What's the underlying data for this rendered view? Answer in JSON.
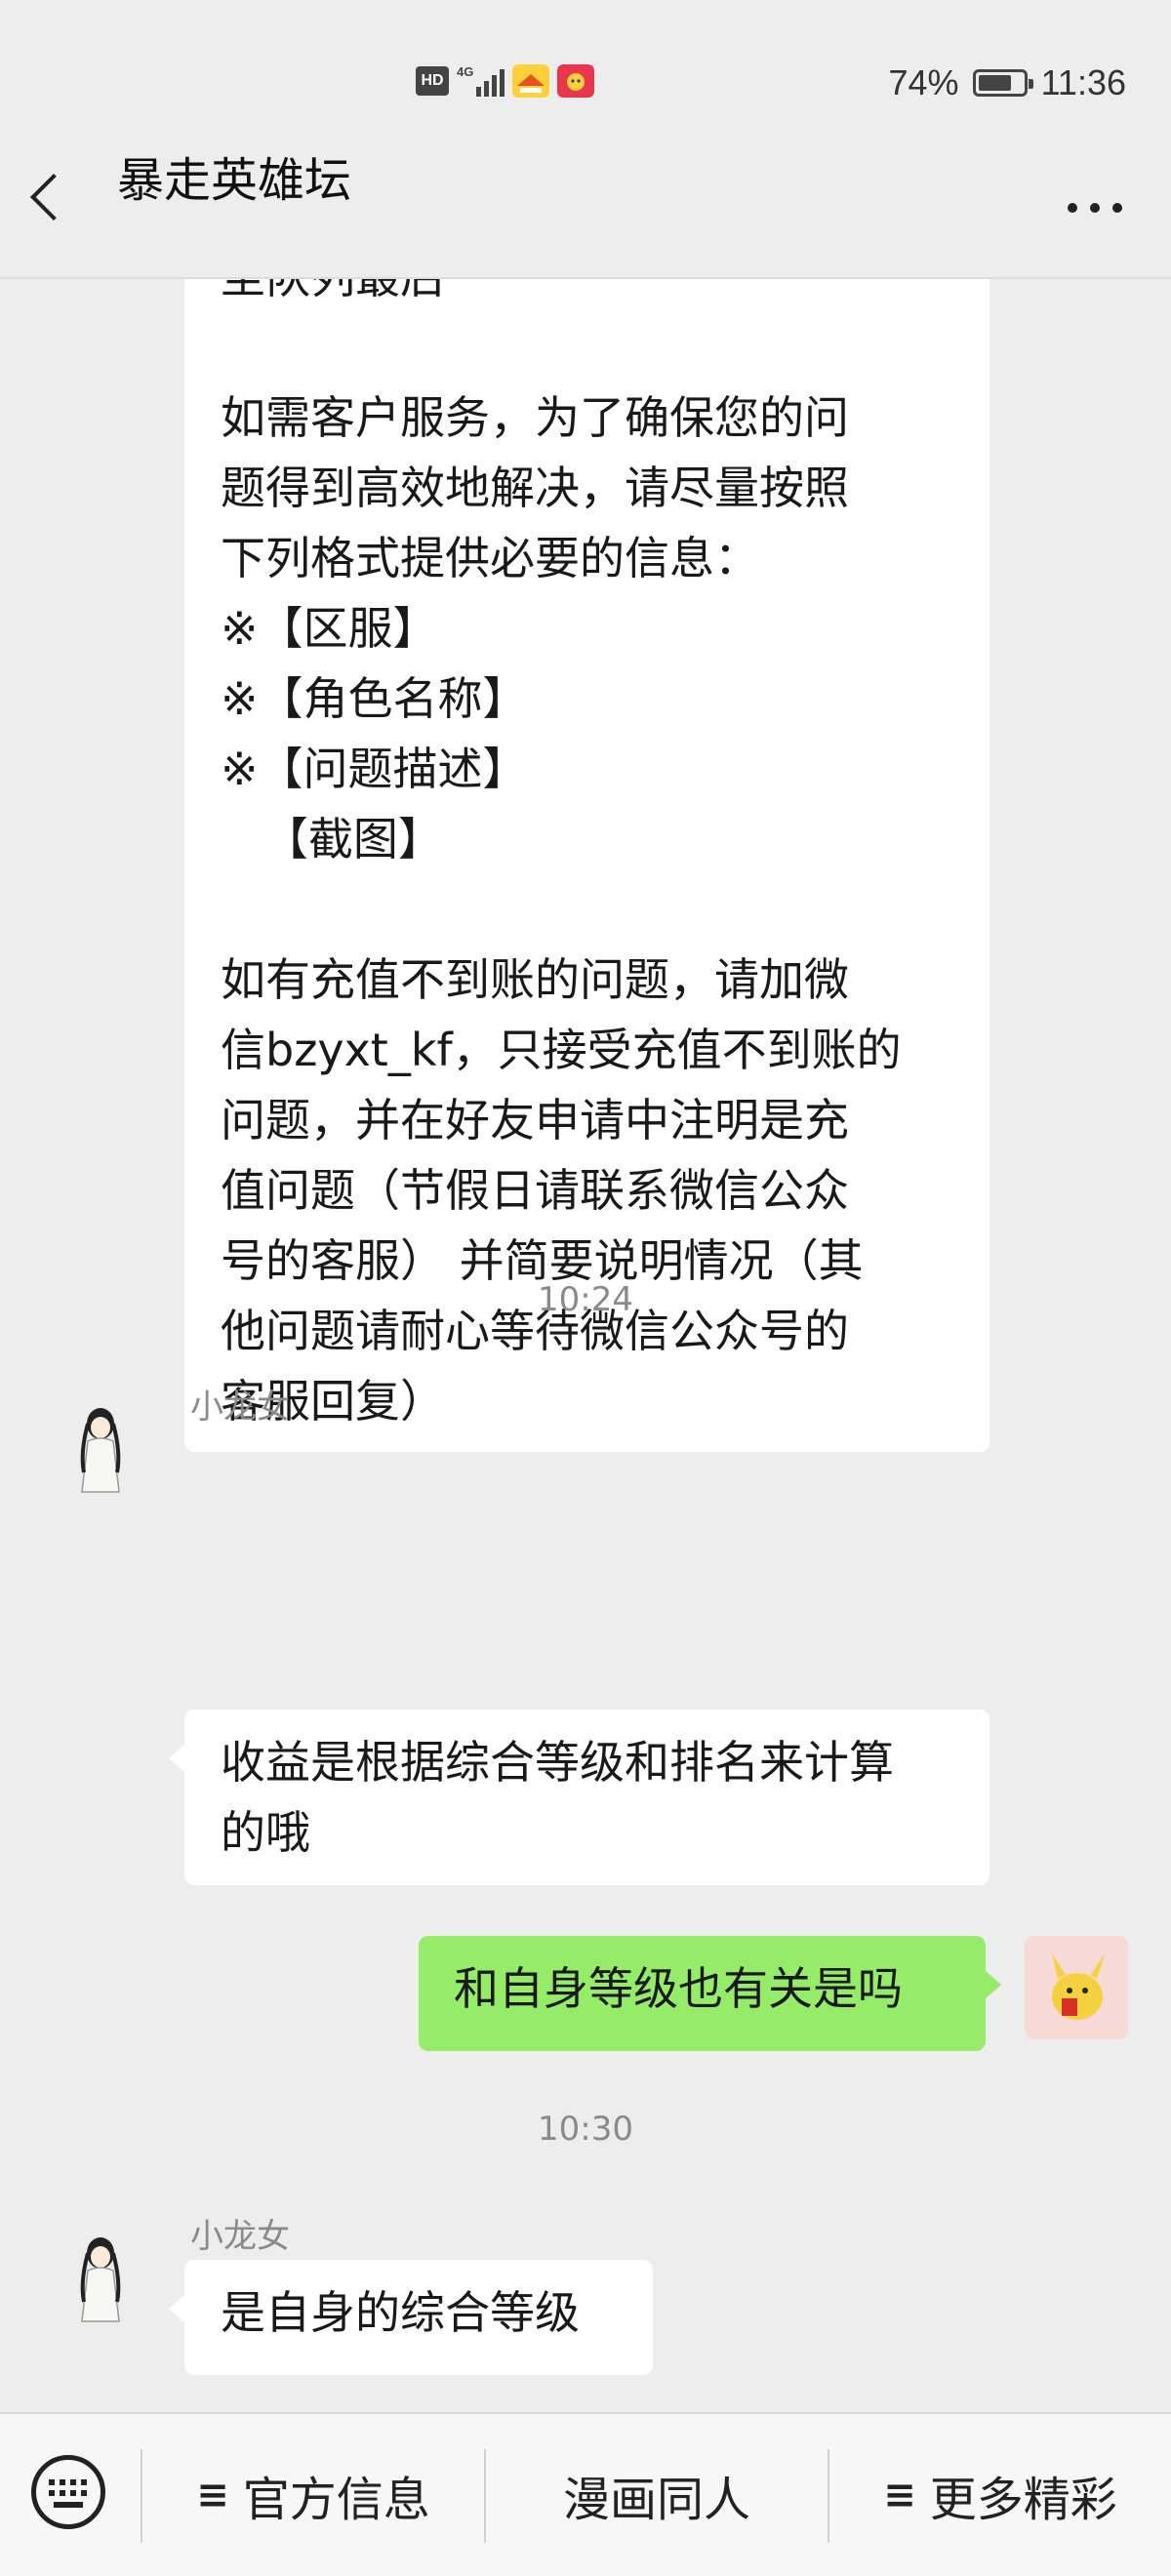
{
  "status_bar": {
    "hd": "HD",
    "network": "4G",
    "battery_percent": "74%",
    "battery_level": 0.74,
    "time": "11:36"
  },
  "nav": {
    "title": "暴走英雄坛",
    "back_icon": "chevron-left-icon",
    "more_icon": "more-dots-icon"
  },
  "messages": {
    "m1_lines": [
      "至队列最后",
      "",
      "如需客户服务，为了确保您的问",
      "题得到高效地解决，请尽量按照",
      "下列格式提供必要的信息：",
      "※【区服】",
      "※【角色名称】",
      "※【问题描述】",
      "   【截图】",
      "",
      "如有充值不到账的问题，请加微",
      "信bzyxt_kf，只接受充值不到账的",
      "问题，并在好友申请中注明是充",
      "值问题（节假日请联系微信公众",
      "号的客服） 并简要说明情况（其",
      "他问题请耐心等待微信公众号的",
      "客服回复）"
    ],
    "ts1": "10:24",
    "sender1": "小龙女",
    "m2_lines": [
      "收益是根据综合等级和排名来计算",
      "的哦"
    ],
    "m3": "和自身等级也有关是吗",
    "ts2": "10:30",
    "sender2": "小龙女",
    "m4": "是自身的综合等级"
  },
  "bottom_menu": {
    "keyboard_icon": "keyboard-icon",
    "items": [
      {
        "label": "官方信息",
        "prefix": "≡"
      },
      {
        "label": "漫画同人",
        "prefix": ""
      },
      {
        "label": "更多精彩",
        "prefix": "≡"
      }
    ]
  },
  "colors": {
    "background": "#ededed",
    "bubble_in": "#ffffff",
    "bubble_out": "#95ec69",
    "meta_text": "#8a8a8a"
  }
}
